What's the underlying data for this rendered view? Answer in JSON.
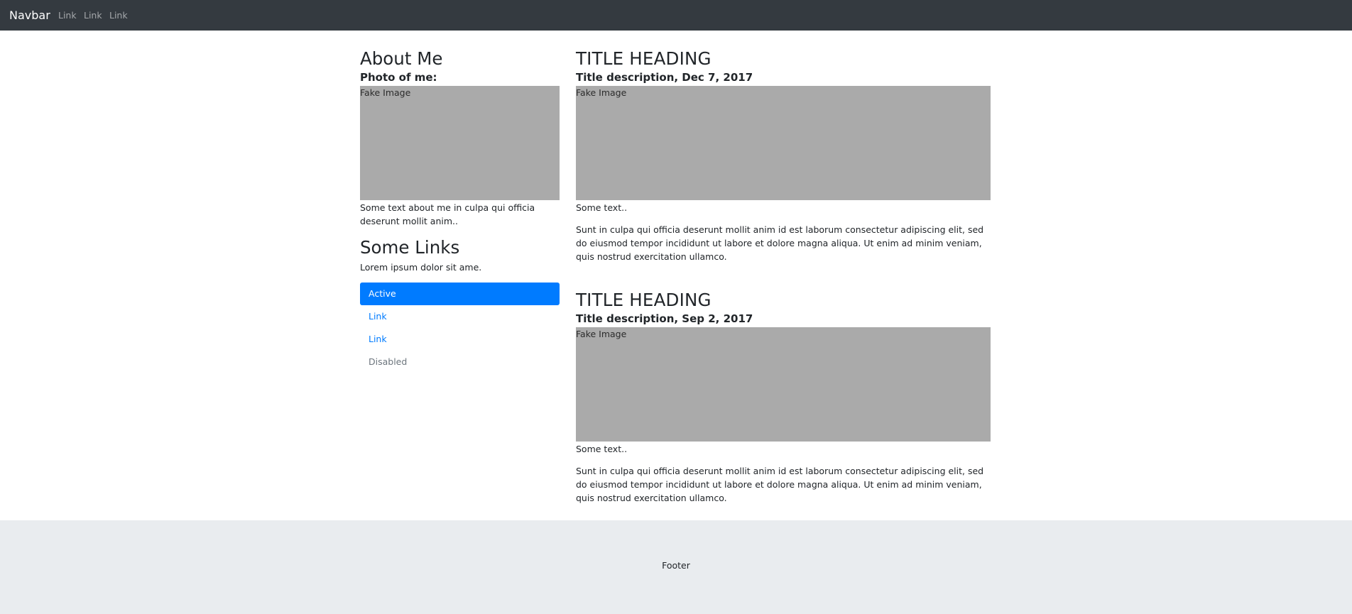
{
  "navbar": {
    "brand": "Navbar",
    "links": [
      "Link",
      "Link",
      "Link"
    ]
  },
  "sidebar": {
    "about_title": "About Me",
    "photo_label": "Photo of me:",
    "image_text": "Fake Image",
    "about_text": "Some text about me in culpa qui officia deserunt mollit anim..",
    "links_title": "Some Links",
    "links_text": "Lorem ipsum dolor sit ame.",
    "list": {
      "active": "Active",
      "link1": "Link",
      "link2": "Link",
      "disabled": "Disabled"
    }
  },
  "posts": [
    {
      "title": "TITLE HEADING",
      "description": "Title description, Dec 7, 2017",
      "image_text": "Fake Image",
      "short_text": "Some text..",
      "body": "Sunt in culpa qui officia deserunt mollit anim id est laborum consectetur adipiscing elit, sed do eiusmod tempor incididunt ut labore et dolore magna aliqua. Ut enim ad minim veniam, quis nostrud exercitation ullamco."
    },
    {
      "title": "TITLE HEADING",
      "description": "Title description, Sep 2, 2017",
      "image_text": "Fake Image",
      "short_text": "Some text..",
      "body": "Sunt in culpa qui officia deserunt mollit anim id est laborum consectetur adipiscing elit, sed do eiusmod tempor incididunt ut labore et dolore magna aliqua. Ut enim ad minim veniam, quis nostrud exercitation ullamco."
    }
  ],
  "footer": {
    "text": "Footer"
  },
  "colors": {
    "navbar_bg": "#343a40",
    "primary": "#007bff",
    "image_placeholder": "#aaaaaa",
    "footer_bg": "#e9ecef"
  }
}
